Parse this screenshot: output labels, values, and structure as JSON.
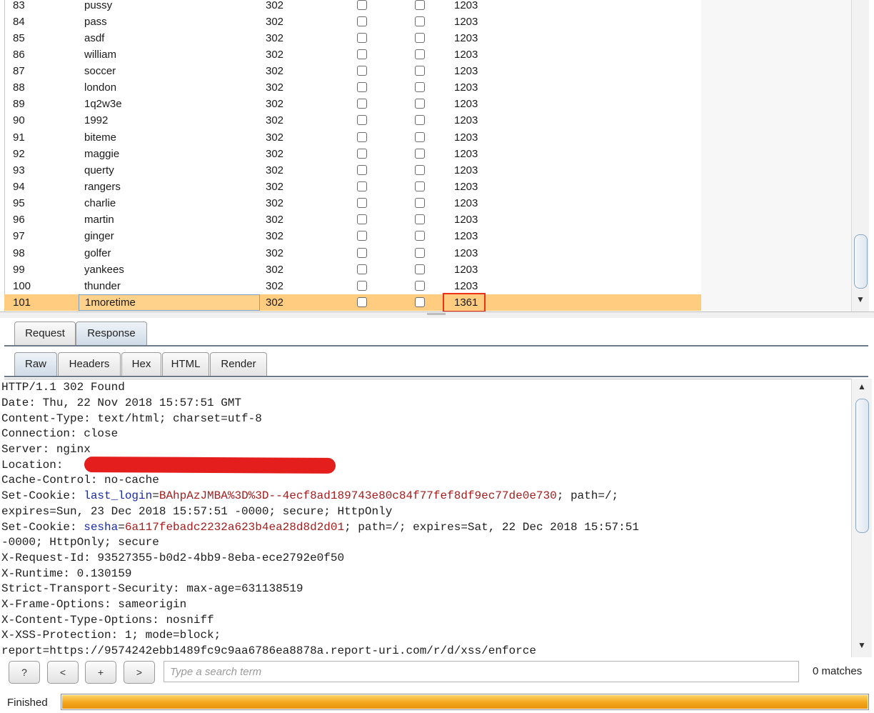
{
  "results": {
    "partial_row": {
      "num": "83",
      "payload": "pussy",
      "status": "302",
      "length": "1203"
    },
    "rows": [
      {
        "num": "84",
        "payload": "pass",
        "status": "302",
        "length": "1203"
      },
      {
        "num": "85",
        "payload": "asdf",
        "status": "302",
        "length": "1203"
      },
      {
        "num": "86",
        "payload": "william",
        "status": "302",
        "length": "1203"
      },
      {
        "num": "87",
        "payload": "soccer",
        "status": "302",
        "length": "1203"
      },
      {
        "num": "88",
        "payload": "london",
        "status": "302",
        "length": "1203"
      },
      {
        "num": "89",
        "payload": "1q2w3e",
        "status": "302",
        "length": "1203"
      },
      {
        "num": "90",
        "payload": "1992",
        "status": "302",
        "length": "1203"
      },
      {
        "num": "91",
        "payload": "biteme",
        "status": "302",
        "length": "1203"
      },
      {
        "num": "92",
        "payload": "maggie",
        "status": "302",
        "length": "1203"
      },
      {
        "num": "93",
        "payload": "querty",
        "status": "302",
        "length": "1203"
      },
      {
        "num": "94",
        "payload": "rangers",
        "status": "302",
        "length": "1203"
      },
      {
        "num": "95",
        "payload": "charlie",
        "status": "302",
        "length": "1203"
      },
      {
        "num": "96",
        "payload": "martin",
        "status": "302",
        "length": "1203"
      },
      {
        "num": "97",
        "payload": "ginger",
        "status": "302",
        "length": "1203"
      },
      {
        "num": "98",
        "payload": "golfer",
        "status": "302",
        "length": "1203"
      },
      {
        "num": "99",
        "payload": "yankees",
        "status": "302",
        "length": "1203"
      },
      {
        "num": "100",
        "payload": "thunder",
        "status": "302",
        "length": "1203"
      }
    ],
    "selected_row": {
      "num": "101",
      "payload": "1moretime",
      "status": "302",
      "length": "1361"
    }
  },
  "tabs": {
    "outer": {
      "request": "Request",
      "response": "Response"
    },
    "inner": {
      "raw": "Raw",
      "headers": "Headers",
      "hex": "Hex",
      "html": "HTML",
      "render": "Render"
    }
  },
  "response": {
    "l1": "HTTP/1.1 302 Found",
    "l2": "Date: Thu, 22 Nov 2018 15:57:51 GMT",
    "l3": "Content-Type: text/html; charset=utf-8",
    "l4": "Connection: close",
    "l5": "Server: nginx",
    "l6": "Location: ",
    "l7": "Cache-Control: no-cache",
    "l8_prefix": "Set-Cookie: ",
    "l8_key": "last_login",
    "l8_eq": "=",
    "l8_val": "BAhpAzJMBA%3D%3D--4ecf8ad189743e80c84f77fef8df9ec77de0e730",
    "l8_suffix": "; path=/;",
    "l9": "expires=Sun, 23 Dec 2018 15:57:51 -0000; secure; HttpOnly",
    "l10_prefix": "Set-Cookie: ",
    "l10_key": "sesha",
    "l10_eq": "=",
    "l10_val": "6a117febadc2232a623b4ea28d8d2d01",
    "l10_suffix": "; path=/; expires=Sat, 22 Dec 2018 15:57:51",
    "l11": "-0000; HttpOnly; secure",
    "l12": "X-Request-Id: 93527355-b0d2-4bb9-8eba-ece2792e0f50",
    "l13": "X-Runtime: 0.130159",
    "l14": "Strict-Transport-Security: max-age=631138519",
    "l15": "X-Frame-Options: sameorigin",
    "l16": "X-Content-Type-Options: nosniff",
    "l17": "X-XSS-Protection: 1; mode=block;",
    "l18": "report=https://9574242ebb1489fc9c9aa6786ea8878a.report-uri.com/r/d/xss/enforce"
  },
  "search": {
    "help_label": "?",
    "prev_label": "<",
    "add_label": "+",
    "next_label": ">",
    "placeholder": "Type a search term",
    "matches": "0 matches"
  },
  "status": {
    "text": "Finished",
    "progress": 1.0
  },
  "colors": {
    "selected_row": "#ffcc80",
    "highlight_box": "#e8321e",
    "redaction": "#e41d1d",
    "cookie_key": "#1a2aa6",
    "cookie_value": "#a31d1d"
  }
}
